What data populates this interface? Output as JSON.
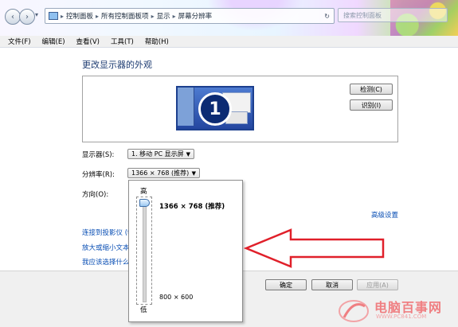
{
  "address": {
    "crumbs": [
      "控制面板",
      "所有控制面板项",
      "显示",
      "屏幕分辨率"
    ],
    "search_placeholder": "搜索控制面板"
  },
  "menu": [
    "文件(F)",
    "编辑(E)",
    "查看(V)",
    "工具(T)",
    "帮助(H)"
  ],
  "page_title": "更改显示器的外观",
  "preview": {
    "monitor_number": "1",
    "detect_label": "检测(C)",
    "identify_label": "识别(I)"
  },
  "fields": {
    "display_label": "显示器(S):",
    "display_value": "1. 移动 PC 显示屏",
    "resolution_label": "分辨率(R):",
    "resolution_value": "1366 × 768 (推荐)",
    "orientation_label": "方向(O):"
  },
  "advanced_link": "高级设置",
  "links": [
    "连接到投影仪 (t",
    "放大或缩小文本",
    "我应该选择什么"
  ],
  "resolution_popup": {
    "high_label": "高",
    "low_label": "低",
    "top_value": "1366 × 768 (推荐)",
    "bottom_value": "800 × 600",
    "slider_position": "top"
  },
  "buttons": {
    "ok": "确定",
    "cancel": "取消",
    "apply": "应用(A)"
  },
  "watermark": {
    "text": "电脑百事网",
    "url": "WWW.PC841.COM"
  },
  "colors": {
    "link": "#0a4fb4",
    "title": "#1e3c72",
    "arrow": "#e0202a",
    "watermark": "#ef7f82"
  }
}
